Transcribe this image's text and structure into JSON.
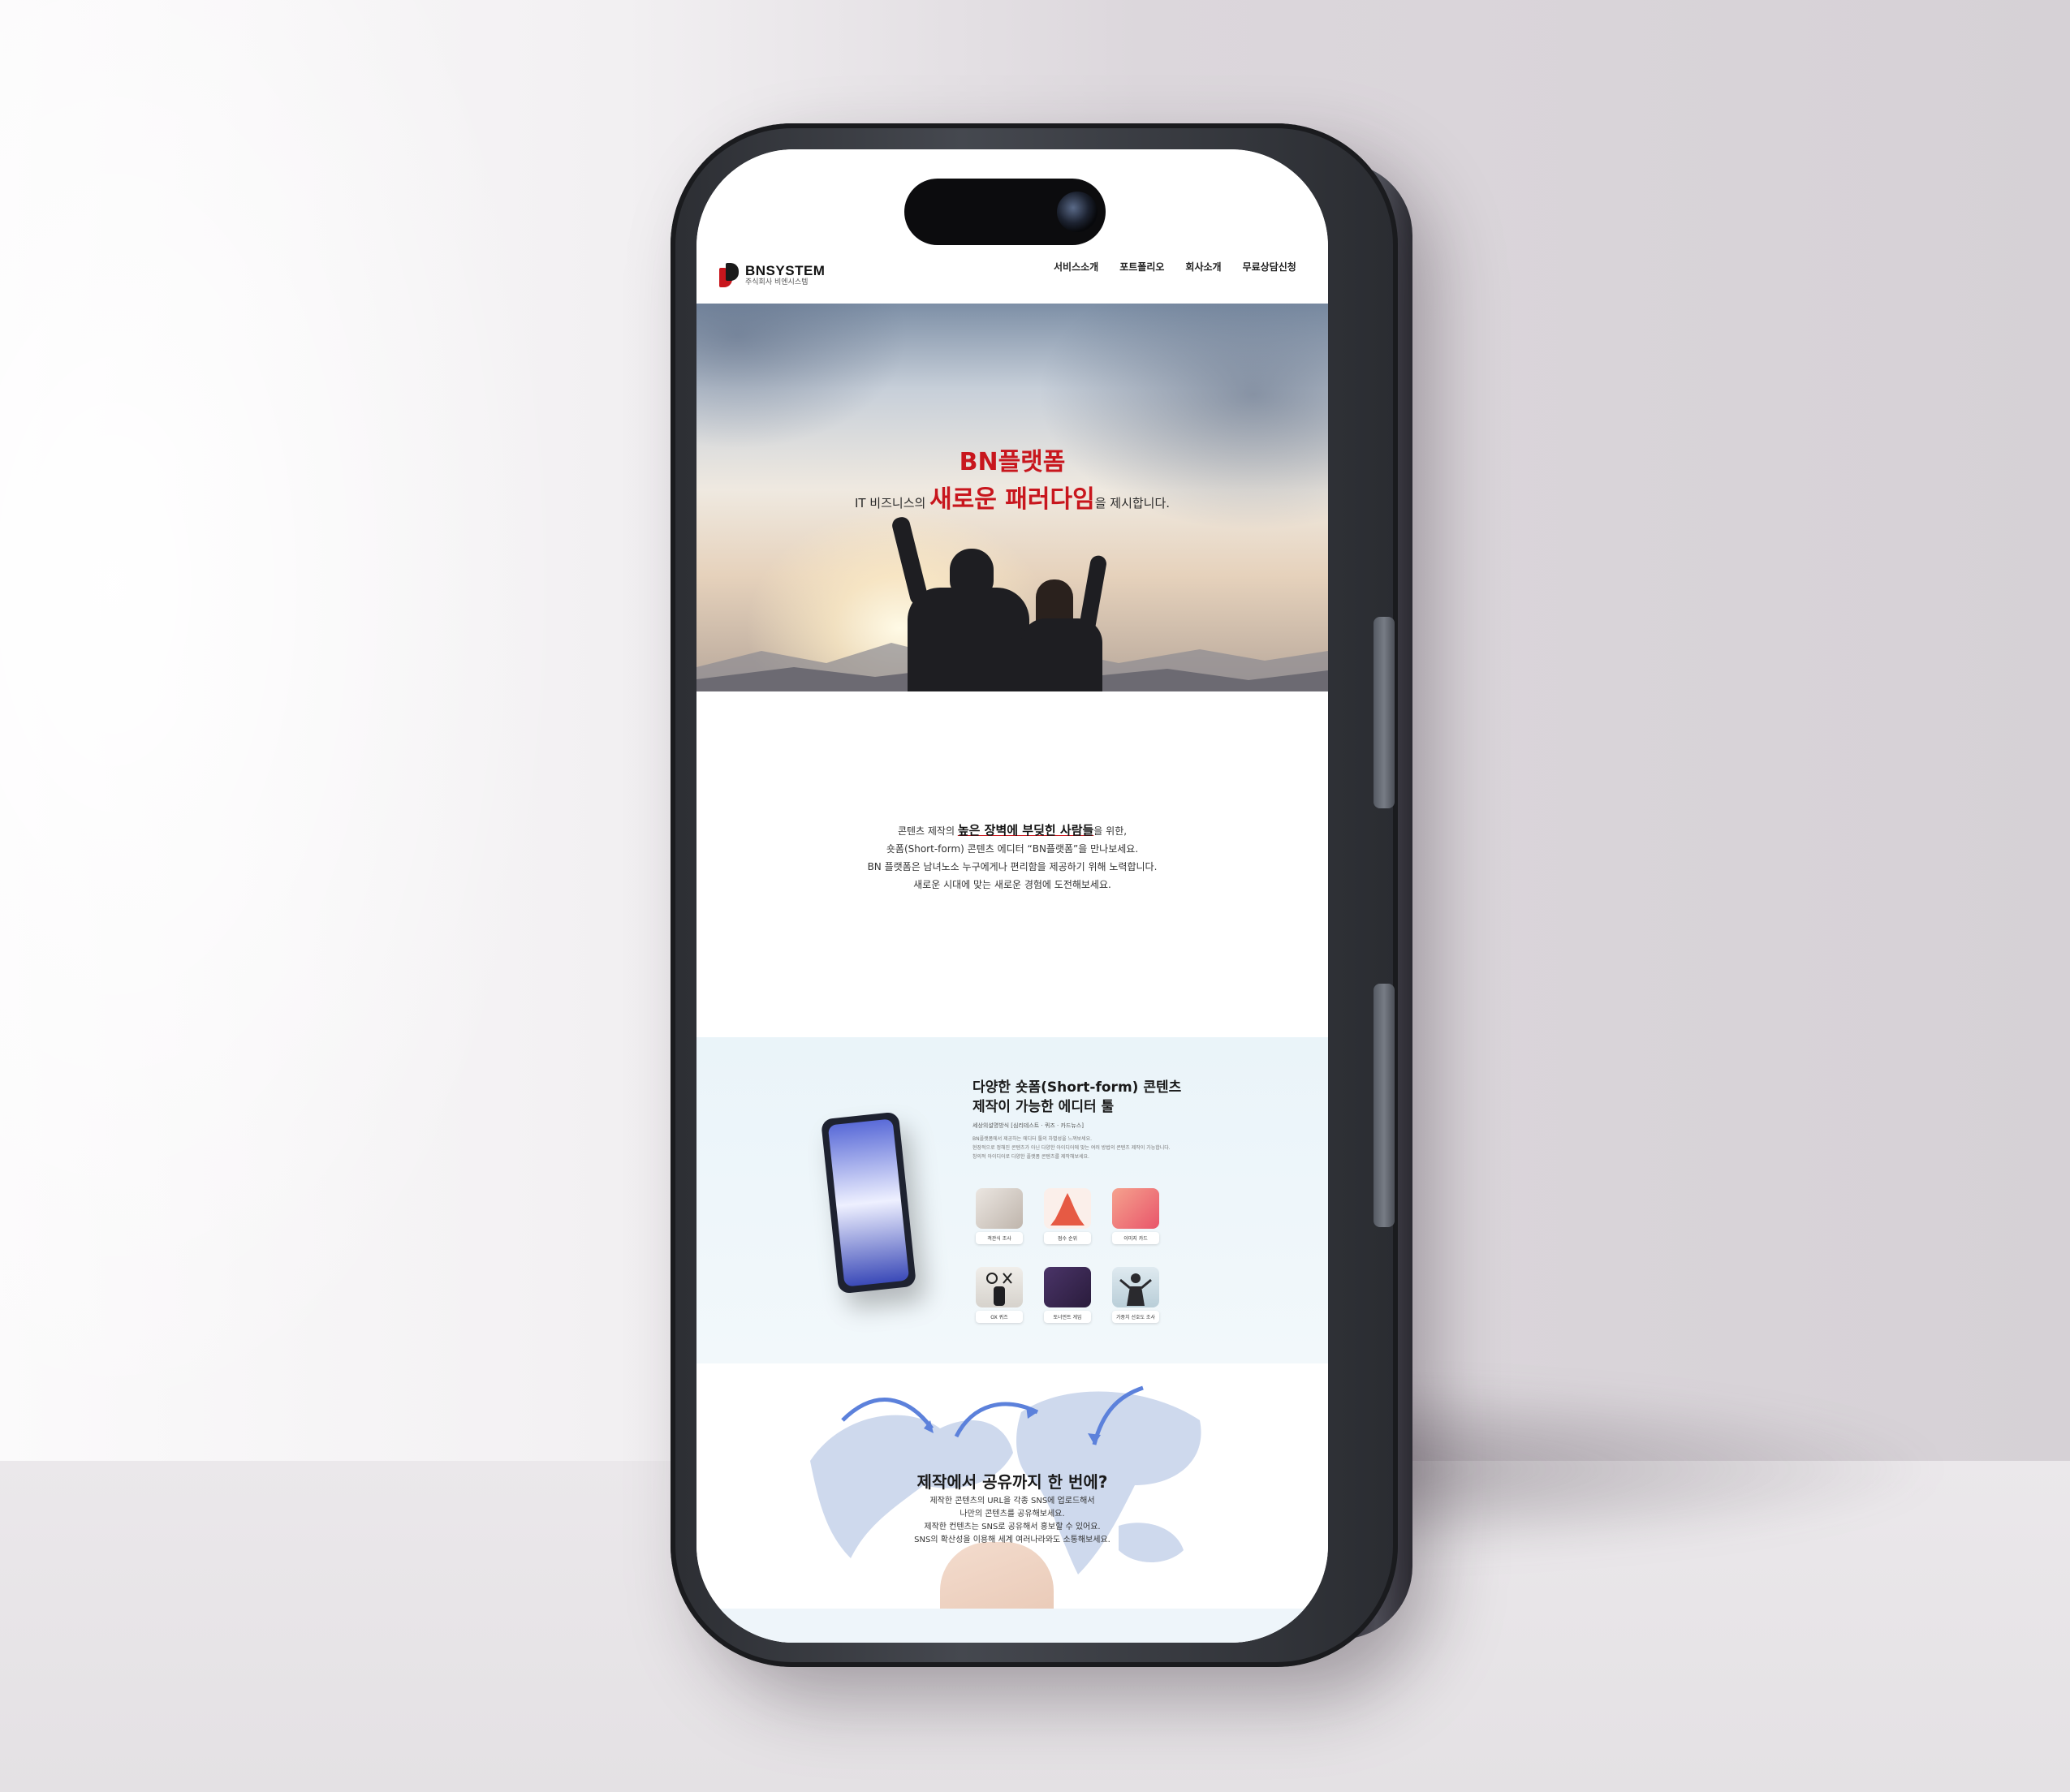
{
  "nav": {
    "logo_name": "BNSYSTEM",
    "logo_sub": "주식회사 비엔시스템",
    "menu": [
      "서비스소개",
      "포트폴리오",
      "회사소개",
      "무료상담신청"
    ]
  },
  "hero": {
    "line1": "BN플랫폼",
    "line2_prefix": "IT 비즈니스의 ",
    "line2_emphasis": "새로운 패러다임",
    "line2_suffix": "을 제시합니다."
  },
  "intro": {
    "line1_prefix": "콘텐츠 제작의 ",
    "line1_emphasis": "높은 장벽에 부딪힌 사람들",
    "line1_suffix": "을 위한,",
    "line2": "숏폼(Short-form) 콘텐츠 에디터 “BN플랫폼”을 만나보세요.",
    "line3": "BN 플랫폼은 남녀노소 누구에게나 편리함을 제공하기 위해 노력합니다.",
    "line4": "새로운 시대에 맞는 새로운 경험에 도전해보세요."
  },
  "tools": {
    "title_line1": "다양한 숏폼(Short-form) 콘텐츠",
    "title_line2": "제작이 가능한 에디터 툴",
    "subtitle": "세상의설명방식 [심리테스트 · 퀴즈 · 카드뉴스]",
    "desc_line1": "BN플랫폼에서 제공하는 에디터 툴의 차별성을 느껴보세요.",
    "desc_line2": "현장적으로 정해진 콘텐츠가 아닌 다양한 아이디어에 맞는 여러 방법의 콘텐츠 제작이 가능합니다.",
    "desc_line3": "창의적 아이디어로 다양한 플랫폼 콘텐츠를 제작해보세요.",
    "items": [
      {
        "label": "객관식 조사",
        "color": "#d9d2cc"
      },
      {
        "label": "점수 순위",
        "color": "#f6e6e0"
      },
      {
        "label": "이미지 카드",
        "color": "#f07a72"
      },
      {
        "label": "OX 퀴즈",
        "color": "#eceae6"
      },
      {
        "label": "토너먼트 게임",
        "color": "#3b2a52"
      },
      {
        "label": "가중치 선호도 조사",
        "color": "#c9dce4"
      }
    ]
  },
  "share": {
    "title": "제작에서 공유까지 한 번에?",
    "line1": "제작한 콘텐츠의 URL을 각종 SNS에 업로드해서",
    "line2": "나만의 콘텐츠를 공유해보세요.",
    "line3": "제작한 컨텐츠는 SNS로 공유해서 홍보할 수 있어요.",
    "line4": "SNS의 확산성을 이용해 세계 여러나라와도 소통해보세요."
  },
  "colors": {
    "brand_red": "#c8161d",
    "phone_frame": "#2c2e33"
  }
}
